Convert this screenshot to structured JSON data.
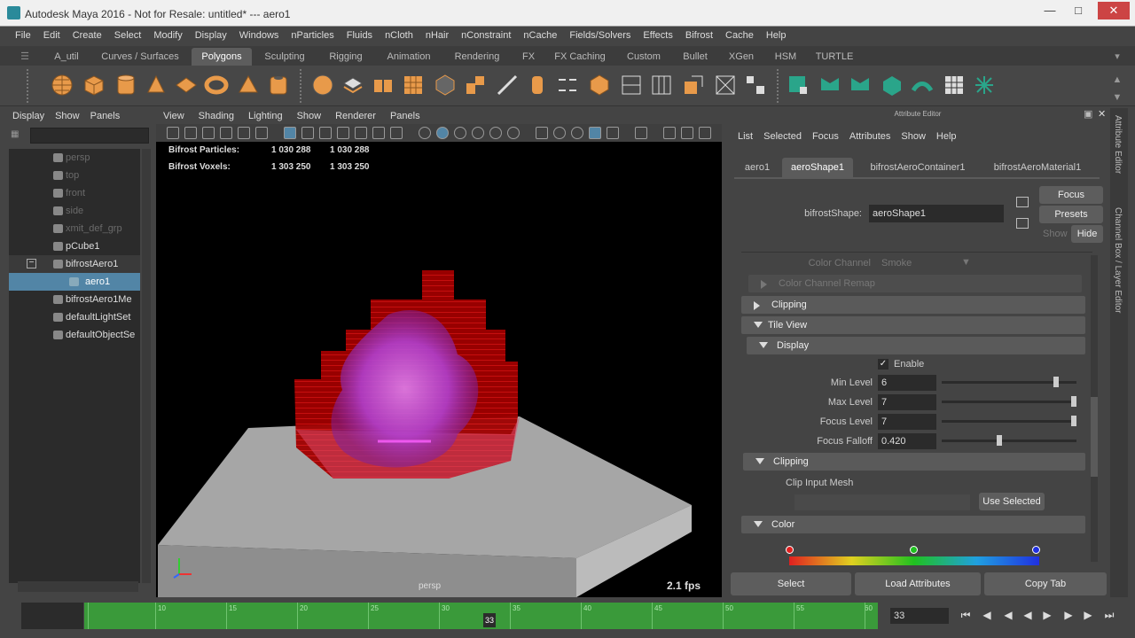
{
  "window": {
    "title": "Autodesk Maya 2016 - Not for Resale: untitled*   ---   aero1"
  },
  "menubar": [
    "File",
    "Edit",
    "Create",
    "Select",
    "Modify",
    "Display",
    "Windows",
    "nParticles",
    "Fluids",
    "nCloth",
    "nHair",
    "nConstraint",
    "nCache",
    "Fields/Solvers",
    "Effects",
    "Bifrost",
    "Cache",
    "Help"
  ],
  "shelf_tabs": [
    "A_util",
    "Curves / Surfaces",
    "Polygons",
    "Sculpting",
    "Rigging",
    "Animation",
    "Rendering",
    "FX",
    "FX Caching",
    "Custom",
    "Bullet",
    "XGen",
    "HSM",
    "TURTLE"
  ],
  "shelf_active": "Polygons",
  "outliner": {
    "menu": [
      "Display",
      "Show",
      "Panels"
    ],
    "items": [
      {
        "label": "persp",
        "state": "dim"
      },
      {
        "label": "top",
        "state": "dim"
      },
      {
        "label": "front",
        "state": "dim"
      },
      {
        "label": "side",
        "state": "dim"
      },
      {
        "label": "xmit_def_grp",
        "state": "dim"
      },
      {
        "label": "pCube1",
        "state": "normal"
      },
      {
        "label": "bifrostAero1",
        "state": "normal"
      },
      {
        "label": "aero1",
        "state": "selected"
      },
      {
        "label": "bifrostAero1Me",
        "state": "normal"
      },
      {
        "label": "defaultLightSet",
        "state": "normal"
      },
      {
        "label": "defaultObjectSe",
        "state": "normal"
      }
    ]
  },
  "viewport": {
    "menu": [
      "View",
      "Shading",
      "Lighting",
      "Show",
      "Renderer",
      "Panels"
    ],
    "hud": {
      "particles_label": "Bifrost Particles:",
      "particles_a": "1 030 288",
      "particles_b": "1 030 288",
      "voxels_label": "Bifrost Voxels:",
      "voxels_a": "1 303 250",
      "voxels_b": "1 303 250",
      "camera": "persp",
      "fps": "2.1 fps"
    }
  },
  "attribute_editor": {
    "title": "Attribute Editor",
    "menu": [
      "List",
      "Selected",
      "Focus",
      "Attributes",
      "Show",
      "Help"
    ],
    "tabs": [
      "aero1",
      "aeroShape1",
      "bifrostAeroContainer1",
      "bifrostAeroMaterial1"
    ],
    "active_tab": "aeroShape1",
    "shape_label": "bifrostShape:",
    "shape_value": "aeroShape1",
    "focus_btn": "Focus",
    "presets_btn": "Presets",
    "show_label": "Show",
    "hide_btn": "Hide",
    "color_channel_label": "Color Channel",
    "color_channel_value": "Smoke",
    "sections": {
      "color_remap": "Color Channel Remap",
      "clipping": "Clipping",
      "tile_view": "Tile View",
      "display": "Display",
      "clipping2": "Clipping",
      "color": "Color"
    },
    "enable_label": "Enable",
    "enable_checked": true,
    "min_level_label": "Min Level",
    "min_level": "6",
    "max_level_label": "Max Level",
    "max_level": "7",
    "focus_level_label": "Focus Level",
    "focus_level": "7",
    "focus_falloff_label": "Focus Falloff",
    "focus_falloff": "0.420",
    "clip_input_label": "Clip Input Mesh",
    "use_selected_btn": "Use Selected",
    "bottom_buttons": [
      "Select",
      "Load Attributes",
      "Copy Tab"
    ]
  },
  "right_sidebar": [
    "Attribute Editor",
    "Channel Box / Layer Editor"
  ],
  "timeline": {
    "ticks": [
      "5",
      "10",
      "15",
      "20",
      "25",
      "30",
      "35",
      "40",
      "45",
      "50",
      "55",
      "60"
    ],
    "current_frame": "33",
    "current_frame_field": "33"
  }
}
